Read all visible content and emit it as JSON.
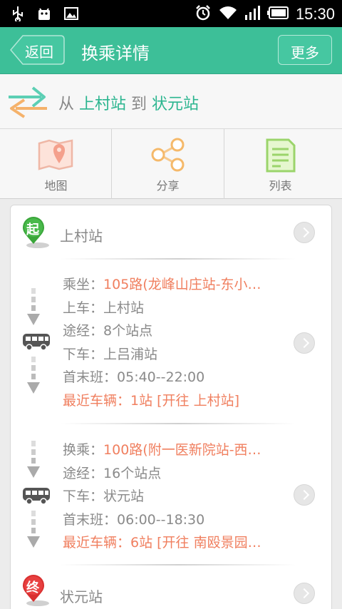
{
  "status_bar": {
    "time": "15:30"
  },
  "header": {
    "back_label": "返回",
    "title": "换乘详情",
    "more_label": "更多"
  },
  "route": {
    "from_word": "从",
    "from_station": "上村站",
    "to_word": "到",
    "to_station": "状元站"
  },
  "tabs": [
    {
      "label": "地图",
      "icon": "map-pin-icon"
    },
    {
      "label": "分享",
      "icon": "share-icon"
    },
    {
      "label": "列表",
      "icon": "list-doc-icon"
    }
  ],
  "start": {
    "badge": "起",
    "station": "上村站"
  },
  "segments": [
    {
      "ride_label": "乘坐：",
      "ride_value": "105路(龙峰山庄站-东小…",
      "board_label": "上车：",
      "board_value": "上村站",
      "via_label": "途经：",
      "via_value": "8个站点",
      "alight_label": "下车：",
      "alight_value": "上吕浦站",
      "schedule_label": "首末班：",
      "schedule_value": "05:40--22:00",
      "nearest_label": "最近车辆：",
      "nearest_value": "1站 [开往 上村站]"
    },
    {
      "ride_label": "换乘：",
      "ride_value": "100路(附一医新院站-西…",
      "via_label": "途经：",
      "via_value": "16个站点",
      "alight_label": "下车：",
      "alight_value": "状元站",
      "schedule_label": "首末班：",
      "schedule_value": "06:00--18:30",
      "nearest_label": "最近车辆：",
      "nearest_value": "6站 [开往 南殴景园…"
    }
  ],
  "end": {
    "badge": "终",
    "station": "状元站"
  },
  "colors": {
    "accent": "#3dbf98",
    "station": "#2bb58f",
    "highlight": "#f07f5f"
  }
}
